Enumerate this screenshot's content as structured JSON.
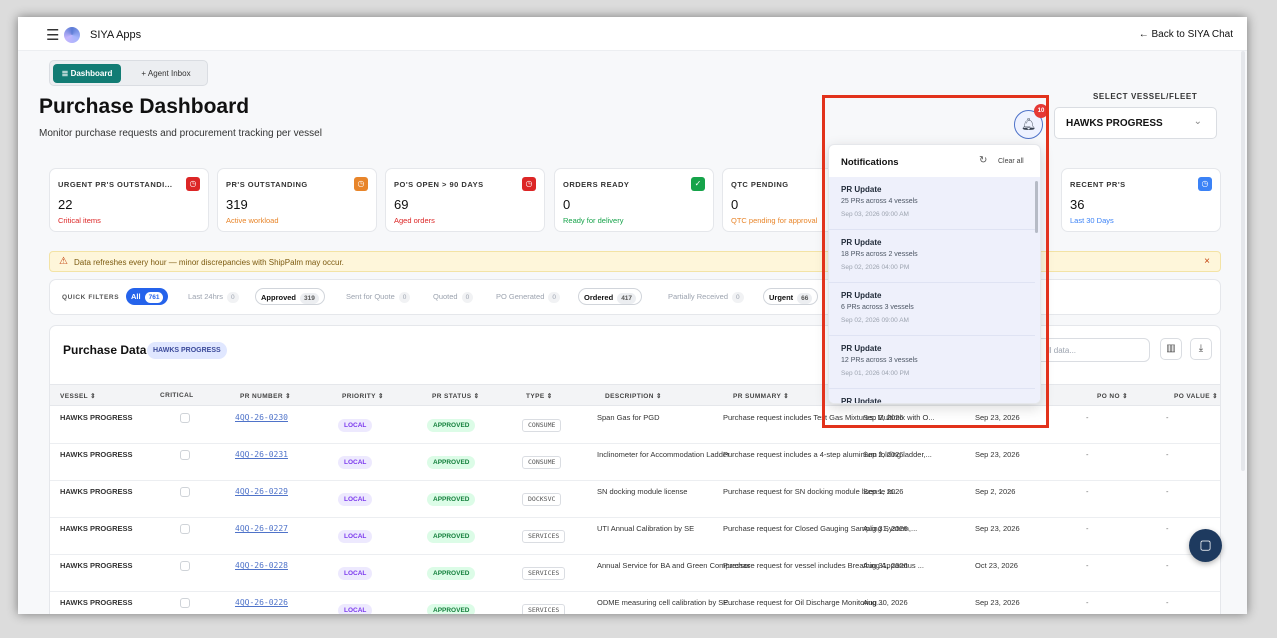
{
  "app": {
    "title": "SIYA Apps",
    "back_label": "Back to SIYA Chat"
  },
  "tabs": {
    "dashboard": "Dashboard",
    "agent_inbox": "+ Agent Inbox"
  },
  "page": {
    "title": "Purchase Dashboard",
    "subtitle": "Monitor purchase requests and procurement tracking per vessel"
  },
  "vessel_select": {
    "label": "SELECT VESSEL/FLEET",
    "value": "HAWKS PROGRESS"
  },
  "bell": {
    "count": "10"
  },
  "cards": [
    {
      "label": "URGENT PR'S OUTSTANDI...",
      "value": "22",
      "sub": "Critical items",
      "color": "#dc2626",
      "sub_color": "#dc2626",
      "icon": "clock-icon"
    },
    {
      "label": "PR'S OUTSTANDING",
      "value": "319",
      "sub": "Active workload",
      "color": "#e8852a",
      "sub_color": "#e8852a",
      "icon": "clock-icon"
    },
    {
      "label": "PO'S OPEN > 90 DAYS",
      "value": "69",
      "sub": "Aged orders",
      "color": "#dc2626",
      "sub_color": "#dc2626",
      "icon": "clock-icon"
    },
    {
      "label": "ORDERS READY",
      "value": "0",
      "sub": "Ready for delivery",
      "color": "#16a34a",
      "sub_color": "#16a34a",
      "icon": "check-icon"
    },
    {
      "label": "QTC PENDING",
      "value": "0",
      "sub": "QTC pending for approval",
      "color": "#e8852a",
      "sub_color": "#e8852a",
      "icon": "clock-icon"
    },
    {
      "label": "RECENT PR'S",
      "value": "36",
      "sub": "Last 30 Days",
      "color": "#3b82f6",
      "sub_color": "#3b82f6",
      "icon": "clock-icon"
    }
  ],
  "banner": {
    "text": "Data refreshes every hour — minor discrepancies with ShipPalm may occur.",
    "close": "×"
  },
  "filters": {
    "label": "QUICK FILTERS",
    "chips": [
      {
        "label": "All",
        "count": "761"
      },
      {
        "label": "Last 24hrs",
        "count": "0"
      },
      {
        "label": "Approved",
        "count": "319"
      },
      {
        "label": "Sent for Quote",
        "count": "0"
      },
      {
        "label": "Quoted",
        "count": "0"
      },
      {
        "label": "PO Generated",
        "count": "0"
      },
      {
        "label": "Ordered",
        "count": "417"
      },
      {
        "label": "Partially Received",
        "count": "0"
      },
      {
        "label": "Urgent",
        "count": "66"
      }
    ]
  },
  "purchase": {
    "title": "Purchase Data",
    "badge": "HAWKS PROGRESS",
    "search_placeholder": "ll data...",
    "columns": {
      "vessel": "VESSEL ⇕",
      "critical": "CRITICAL",
      "pr_number": "PR NUMBER ⇕",
      "priority": "PRIORITY ⇕",
      "pr_status": "PR STATUS ⇕",
      "type": "TYPE ⇕",
      "description": "DESCRIPTION ⇕",
      "pr_summary": "PR SUMMARY ⇕",
      "po_no": "PO NO ⇕",
      "po_value": "PO VALUE ⇕"
    },
    "rows": [
      {
        "vessel": "HAWKS PROGRESS",
        "pr": "4QQ-26-0230",
        "priority": "LOCAL",
        "status": "APPROVED",
        "type": "CONSUME",
        "desc": "Span Gas for PGD",
        "summary": "Purchase request includes Test Gas Mixtures: Multimix with O...",
        "d1": "Sep 2, 2026",
        "d2": "Sep 23, 2026",
        "po": "-",
        "pv": "-"
      },
      {
        "vessel": "HAWKS PROGRESS",
        "pr": "4QQ-26-0231",
        "priority": "LOCAL",
        "status": "APPROVED",
        "type": "CONSUME",
        "desc": "Inclinometer for Accommodation Ladder",
        "summary": "Purchase request includes a 4-step aluminium folding ladder,...",
        "d1": "Sep 2, 2026",
        "d2": "Sep 23, 2026",
        "po": "-",
        "pv": "-"
      },
      {
        "vessel": "HAWKS PROGRESS",
        "pr": "4QQ-26-0229",
        "priority": "LOCAL",
        "status": "APPROVED",
        "type": "DOCKSVC",
        "desc": "SN docking module license",
        "summary": "Purchase request for SN docking module license to...",
        "d1": "Sep 1, 2026",
        "d2": "Sep 2, 2026",
        "po": "-",
        "pv": "-"
      },
      {
        "vessel": "HAWKS PROGRESS",
        "pr": "4QQ-26-0227",
        "priority": "LOCAL",
        "status": "APPROVED",
        "type": "SERVICES",
        "desc": "UTI Annual Calibration by SE",
        "summary": "Purchase request for Closed Gauging Sampling System,...",
        "d1": "Aug 31, 2026",
        "d2": "Sep 23, 2026",
        "po": "-",
        "pv": "-"
      },
      {
        "vessel": "HAWKS PROGRESS",
        "pr": "4QQ-26-0228",
        "priority": "LOCAL",
        "status": "APPROVED",
        "type": "SERVICES",
        "desc": "Annual Service for BA and Green Compressor",
        "summary": "Purchase request for vessel includes Breathing Apparatus ...",
        "d1": "Aug 31, 2026",
        "d2": "Oct 23, 2026",
        "po": "-",
        "pv": "-"
      },
      {
        "vessel": "HAWKS PROGRESS",
        "pr": "4QQ-26-0226",
        "priority": "LOCAL",
        "status": "APPROVED",
        "type": "SERVICES",
        "desc": "ODME measuring cell calibration by SE...",
        "summary": "Purchase request for Oil Discharge Monitoring...",
        "d1": "Aug 30, 2026",
        "d2": "Sep 23, 2026",
        "po": "-",
        "pv": "-"
      }
    ]
  },
  "notifications": {
    "title": "Notifications",
    "clear": "Clear all",
    "items": [
      {
        "title": "PR Update",
        "body": "25 PRs across 4 vessels",
        "time": "Sep 03, 2026 09:00 AM"
      },
      {
        "title": "PR Update",
        "body": "18 PRs across 2 vessels",
        "time": "Sep 02, 2026 04:00 PM"
      },
      {
        "title": "PR Update",
        "body": "6 PRs across 3 vessels",
        "time": "Sep 02, 2026 09:00 AM"
      },
      {
        "title": "PR Update",
        "body": "12 PRs across 3 vessels",
        "time": "Sep 01, 2026 04:00 PM"
      },
      {
        "title": "PR Update",
        "body": "",
        "time": ""
      }
    ]
  }
}
